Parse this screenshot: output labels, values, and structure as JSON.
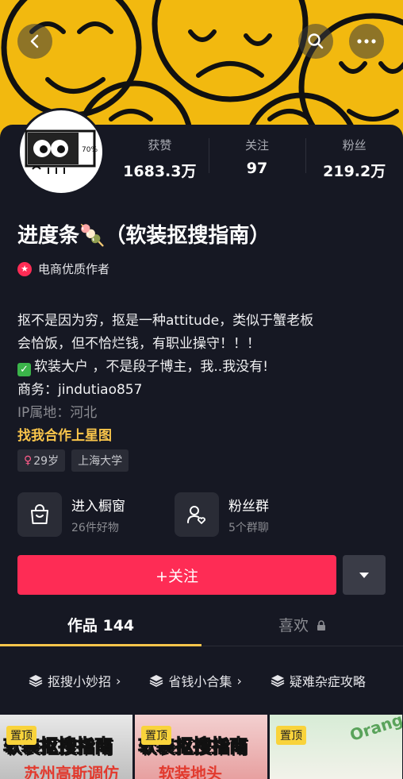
{
  "nav": {
    "back_icon": "chevron-left-icon",
    "search_icon": "search-icon",
    "more_icon": "more-icon"
  },
  "stats": [
    {
      "label": "获赞",
      "value": "1683.3万"
    },
    {
      "label": "关注",
      "value": "97"
    },
    {
      "label": "粉丝",
      "value": "219.2万"
    }
  ],
  "profile": {
    "name": "进度条🍡（软装抠搜指南）",
    "badge": "电商优质作者",
    "bio_line1": "抠不是因为穷，抠是一种attitude，类似于蟹老板",
    "bio_line2": "会恰饭，但不恰烂钱，有职业操守！！！",
    "bio_line3": "软装大户 ，不是段子博主，我..我没有!",
    "bio_line4": "商务：jindutiao857",
    "ip": "IP属地：河北",
    "star_link": "找我合作上星图",
    "tag_age": "29岁",
    "tag_school": "上海大学"
  },
  "shortcuts": [
    {
      "title": "进入橱窗",
      "sub": "26件好物"
    },
    {
      "title": "粉丝群",
      "sub": "5个群聊"
    }
  ],
  "follow_label": "+关注",
  "tabs": {
    "works": "作品 144",
    "likes": "喜欢"
  },
  "collections": [
    "抠搜小妙招",
    "省钱小合集",
    "疑难杂症攻略"
  ],
  "thumbs": [
    {
      "pin": "置顶",
      "title": "软装抠搜指南",
      "sub": "苏州高斯调仿"
    },
    {
      "pin": "置顶",
      "title": "软装抠搜指南",
      "sub": "软装地头"
    },
    {
      "pin": "置顶",
      "title": "Orang",
      "sub": ""
    }
  ],
  "colors": {
    "accent": "#fe2c55",
    "gold": "#f9c54b",
    "background": "#161823"
  }
}
